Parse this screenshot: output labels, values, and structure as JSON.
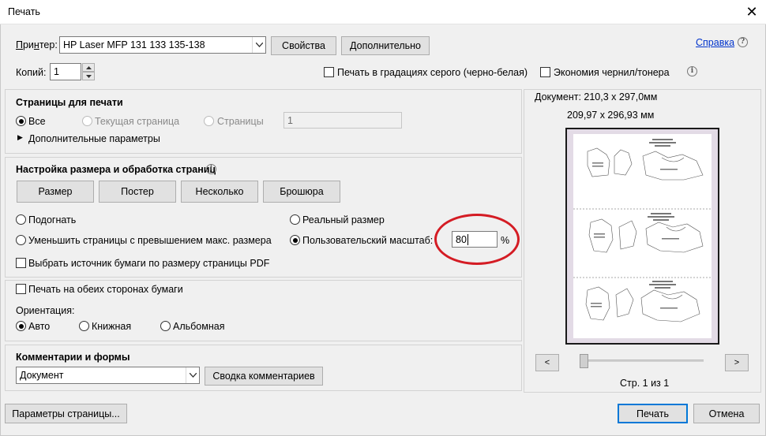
{
  "window": {
    "title": "Печать",
    "close_glyph": "✕"
  },
  "printer": {
    "label": "Принтер:",
    "selected": "HP Laser MFP 131 133 135-138",
    "properties_button": "Свойства",
    "advanced_button": "Дополнительно",
    "help_link": "Справка",
    "help_icon": "?"
  },
  "copies": {
    "label": "Копий:",
    "value": "1"
  },
  "options": {
    "grayscale": "Печать в градациях серого (черно-белая)",
    "grayscale_checked": false,
    "save_ink": "Экономия чернил/тонера",
    "save_ink_checked": false,
    "info_icon": "i"
  },
  "pages": {
    "title": "Страницы для печати",
    "all": "Все",
    "current": "Текущая страница",
    "pages": "Страницы",
    "pages_value": "1",
    "more": "Дополнительные параметры",
    "selected": "all"
  },
  "sizing": {
    "title": "Настройка размера и обработка страниц",
    "info_icon": "i",
    "buttons": [
      "Размер",
      "Постер",
      "Несколько",
      "Брошюра"
    ],
    "fit": "Подогнать",
    "actual_size": "Реальный размер",
    "shrink": "Уменьшить страницы с превышением макс. размера",
    "custom_scale": "Пользовательский масштаб:",
    "custom_scale_value": "80",
    "percent": "%",
    "paper_source": "Выбрать источник бумаги по размеру страницы PDF",
    "selected": "custom_scale"
  },
  "duplex": {
    "label": "Печать на обеих сторонах бумаги",
    "checked": false
  },
  "orientation": {
    "label": "Ориентация:",
    "auto": "Авто",
    "portrait": "Книжная",
    "landscape": "Альбомная",
    "selected": "auto"
  },
  "comments": {
    "title": "Комментарии и формы",
    "selected": "Документ",
    "summary_button": "Сводка комментариев"
  },
  "preview": {
    "document_size": "Документ: 210,3 x 297,0мм",
    "page_size": "209,97 x 296,93 мм",
    "prev": "<",
    "next": ">",
    "page_indicator": "Стр. 1 из 1"
  },
  "footer": {
    "page_setup": "Параметры страницы...",
    "print": "Печать",
    "cancel": "Отмена"
  }
}
